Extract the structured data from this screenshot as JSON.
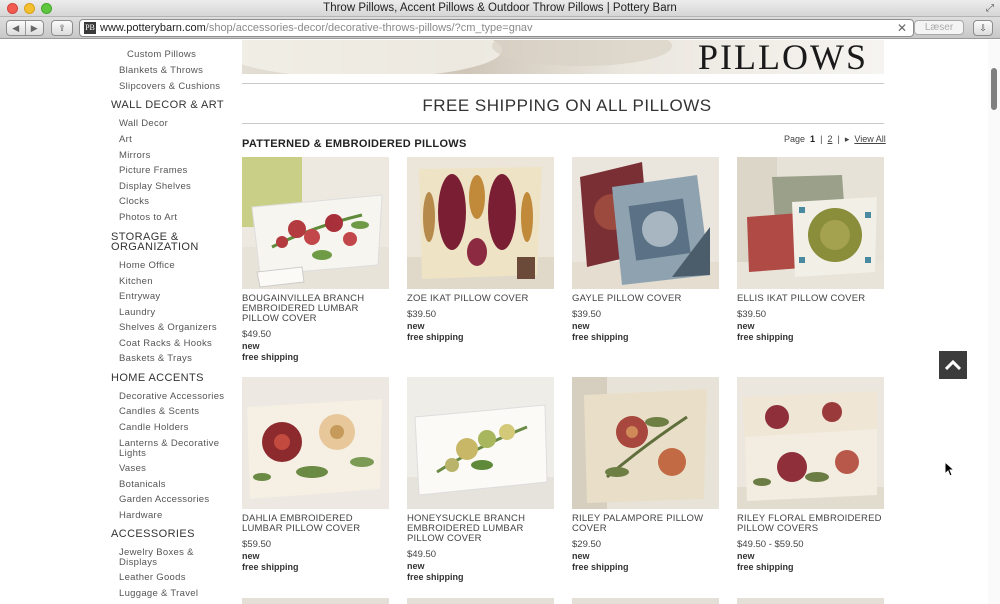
{
  "window": {
    "title": "Throw Pillows, Accent Pillows & Outdoor Throw Pillows | Pottery Barn"
  },
  "toolbar": {
    "url_host": "www.potterybarn.com",
    "url_path": "/shop/accessories-decor/decorative-throws-pillows/?cm_type=gnav",
    "reader_label": "Læser",
    "favicon_glyph": "PB"
  },
  "sidebar": {
    "items_top": [
      "Custom Pillows",
      "Blankets & Throws",
      "Slipcovers & Cushions"
    ],
    "wall_decor": {
      "heading": "WALL DECOR & ART",
      "items": [
        "Wall Decor",
        "Art",
        "Mirrors",
        "Picture Frames",
        "Display Shelves",
        "Clocks",
        "Photos to Art"
      ]
    },
    "storage": {
      "heading_line1": "STORAGE &",
      "heading_line2": "ORGANIZATION",
      "items": [
        "Home Office",
        "Kitchen",
        "Entryway",
        "Laundry",
        "Shelves & Organizers",
        "Coat Racks & Hooks",
        "Baskets & Trays"
      ]
    },
    "home_accents": {
      "heading": "HOME ACCENTS",
      "items": [
        "Decorative Accessories",
        "Candles & Scents",
        "Candle Holders",
        "Lanterns & Decorative",
        "Lights",
        "Vases",
        "Botanicals",
        "Garden Accessories",
        "Hardware"
      ]
    },
    "accessories": {
      "heading": "ACCESSORIES",
      "items": [
        "Jewelry Boxes &",
        "Displays",
        "Leather Goods",
        "Luggage & Travel"
      ]
    }
  },
  "banner": {
    "word": "PILLOWS"
  },
  "promo": {
    "text": "FREE SHIPPING ON ALL PILLOWS"
  },
  "section": {
    "title": "PATTERNED & EMBROIDERED PILLOWS"
  },
  "pager": {
    "label": "Page",
    "current": "1",
    "sep": "|",
    "next": "2",
    "view_all": "View All"
  },
  "products": [
    {
      "name": [
        "BOUGAINVILLEA BRANCH",
        "EMBROIDERED LUMBAR",
        "PILLOW COVER"
      ],
      "price": "$49.50",
      "new": "new",
      "shipping": "free shipping"
    },
    {
      "name": [
        "ZOE IKAT PILLOW COVER"
      ],
      "price": "$39.50",
      "new": "new",
      "shipping": "free shipping"
    },
    {
      "name": [
        "GAYLE PILLOW COVER"
      ],
      "price": "$39.50",
      "new": "new",
      "shipping": "free shipping"
    },
    {
      "name": [
        "ELLIS IKAT PILLOW COVER"
      ],
      "price": "$39.50",
      "new": "new",
      "shipping": "free shipping"
    },
    {
      "name": [
        "DAHLIA EMBROIDERED",
        "LUMBAR PILLOW COVER"
      ],
      "price": "$59.50",
      "new": "new",
      "shipping": "free shipping"
    },
    {
      "name": [
        "HONEYSUCKLE BRANCH",
        "EMBROIDERED LUMBAR",
        "PILLOW COVER"
      ],
      "price": "$49.50",
      "new": "new",
      "shipping": "free shipping"
    },
    {
      "name": [
        "RILEY PALAMPORE PILLOW",
        "COVER"
      ],
      "price": "$29.50",
      "new": "new",
      "shipping": "free shipping"
    },
    {
      "name": [
        "RILEY FLORAL EMBROIDERED",
        "PILLOW COVERS"
      ],
      "price": "$49.50 - $59.50",
      "new": "new",
      "shipping": "free shipping"
    }
  ],
  "colors": {
    "backtop_bg": "#3b3b3b",
    "rule": "#c9c9c9"
  }
}
